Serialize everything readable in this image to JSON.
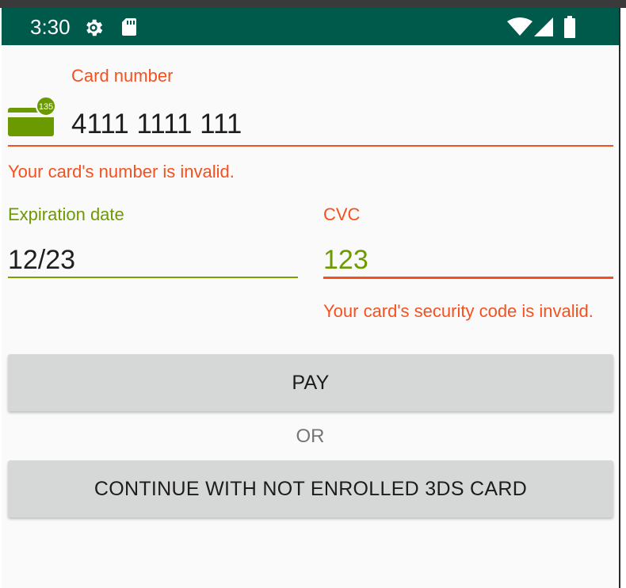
{
  "status_bar": {
    "time": "3:30",
    "icons": [
      "gear-icon",
      "sd-card-icon",
      "wifi-icon",
      "signal-icon",
      "battery-icon"
    ],
    "background": "#005a4c"
  },
  "card_number": {
    "label": "Card number",
    "value": "4111 1111 111",
    "error": "Your card's number is invalid.",
    "icon": "credit-card-icon",
    "icon_badge": "135"
  },
  "expiration_date": {
    "label": "Expiration date",
    "value": "12/23"
  },
  "cvc": {
    "label": "CVC",
    "value": "123",
    "error": "Your card's security code is invalid."
  },
  "actions": {
    "pay_label": "PAY",
    "or_label": "OR",
    "continue_label": "CONTINUE WITH NOT ENROLLED 3DS CARD"
  },
  "colors": {
    "error": "#f4511e",
    "valid": "#6e9a00",
    "button": "#d6d7d7"
  }
}
